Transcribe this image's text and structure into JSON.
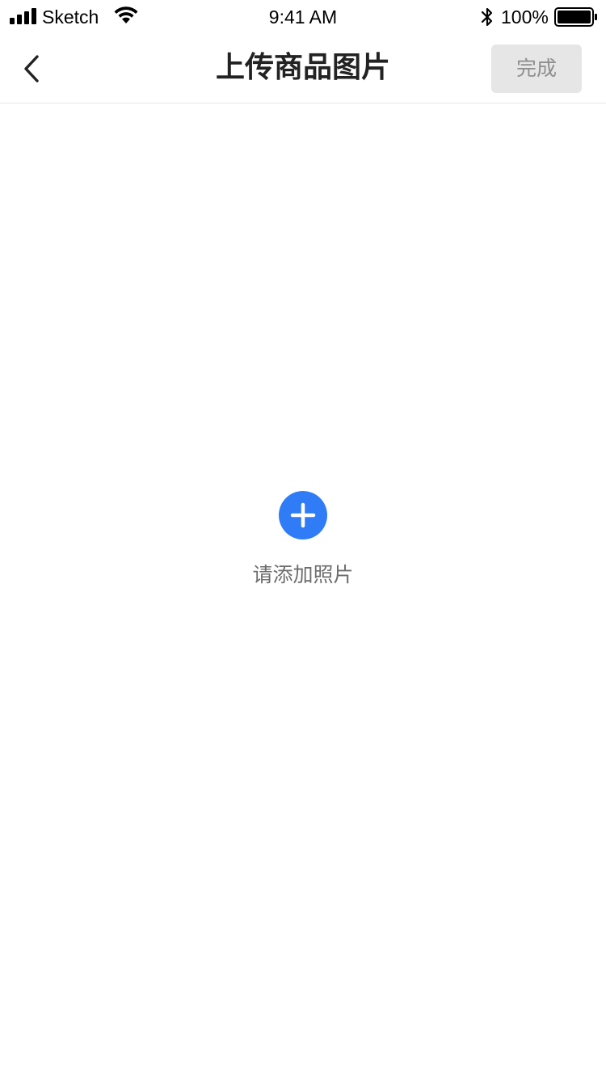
{
  "status_bar": {
    "carrier": "Sketch",
    "time": "9:41 AM",
    "battery_percent": "100%",
    "signal_icon": "signal-bars-icon",
    "wifi_icon": "wifi-icon",
    "bluetooth_icon": "bluetooth-icon",
    "battery_icon": "battery-full-icon",
    "battery_level": 1.0
  },
  "nav": {
    "title": "上传商品图片",
    "back_icon": "chevron-left-icon",
    "done_label": "完成"
  },
  "content": {
    "add_icon": "plus-circle-icon",
    "add_label": "请添加照片"
  },
  "colors": {
    "accent": "#2f7cf6",
    "done_bg": "#e6e6e6",
    "done_text": "#8e8e8e",
    "title_text": "#222222",
    "label_text": "#6d6d6d",
    "divider": "#e6e6e6"
  }
}
